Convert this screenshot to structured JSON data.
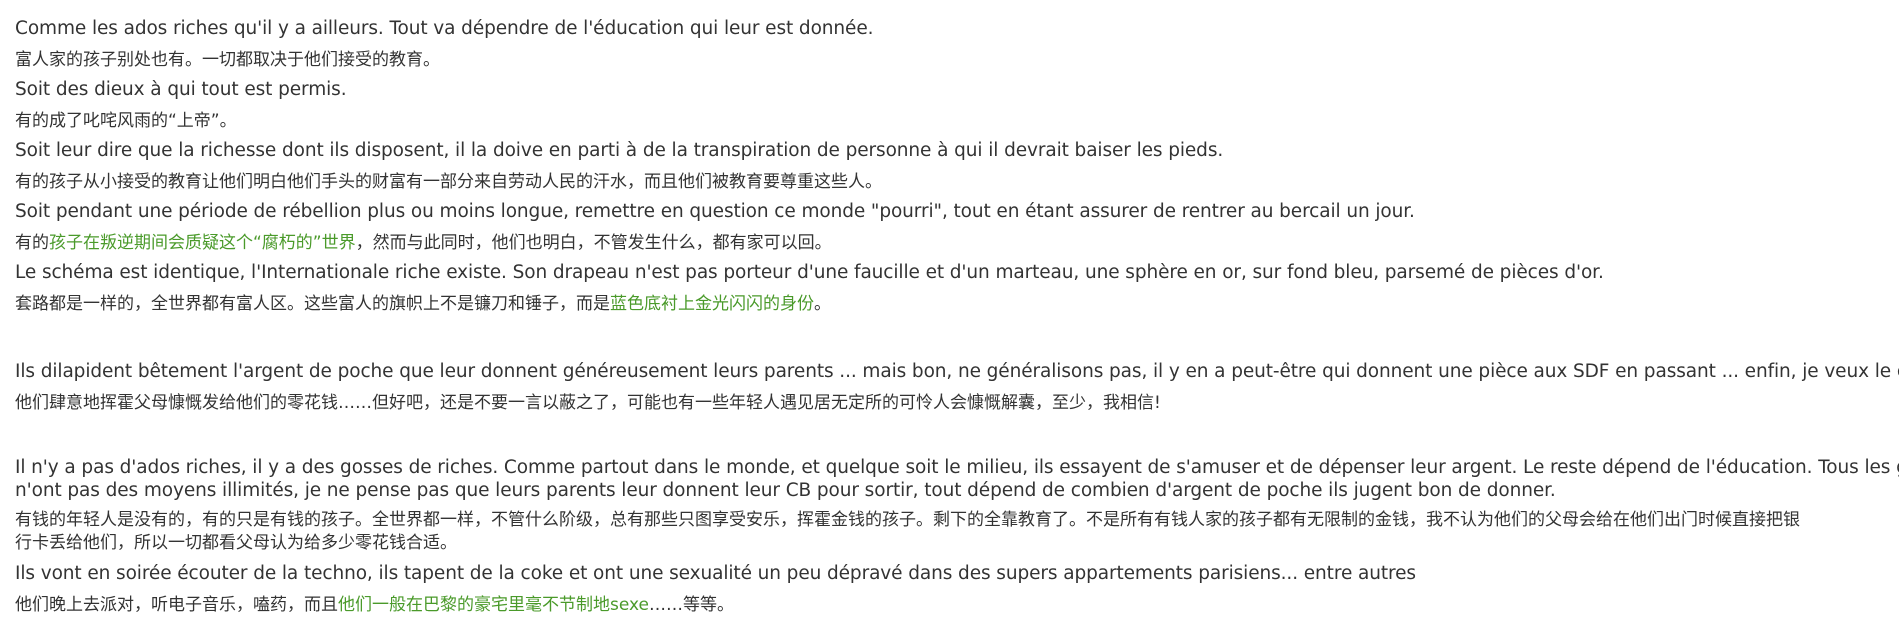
{
  "lines": [
    {
      "lang": "fr",
      "text": "Comme les ados riches qu'il y a ailleurs. Tout va dépendre de l'éducation qui leur est donnée."
    },
    {
      "lang": "zh",
      "text": "富人家的孩子别处也有。一切都取决于他们接受的教育。"
    },
    {
      "lang": "fr",
      "text": "Soit des dieux à qui tout est permis."
    },
    {
      "lang": "zh",
      "text": "有的成了叱咤风雨的“上帝”。"
    },
    {
      "lang": "fr",
      "text": "Soit leur dire que la richesse dont ils disposent, il la doive en parti à de la transpiration de personne à qui il devrait baiser les pieds."
    },
    {
      "lang": "zh",
      "text": "有的孩子从小接受的教育让他们明白他们手头的财富有一部分来自劳动人民的汗水，而且他们被教育要尊重这些人。"
    },
    {
      "lang": "fr",
      "text": "Soit pendant une période de rébellion plus ou moins longue, remettre en question ce monde \"pourri\", tout en étant assurer de rentrer au bercail un jour."
    },
    {
      "lang": "zh",
      "pre": "有的",
      "hl": "孩子在叛逆期间会质疑这个“腐朽的”世界",
      "post": "，然而与此同时，他们也明白，不管发生什么，都有家可以回。"
    },
    {
      "lang": "fr",
      "text": "Le schéma est identique, l'Internationale riche existe. Son drapeau n'est pas porteur d'une faucille et d'un marteau, une sphère en or, sur fond bleu, parsemé de pièces d'or."
    },
    {
      "lang": "zh",
      "pre": "套路都是一样的，全世界都有富人区。这些富人的旗帜上不是镰刀和锤子，而是",
      "hl": "蓝色底衬上金光闪闪的身份",
      "post": "。"
    }
  ],
  "block2": [
    {
      "lang": "fr",
      "text": "Ils dilapident bêtement l'argent de poche que leur donnent généreusement leurs parents ... mais bon, ne généralisons pas, il y en a peut-être qui donnent une pièce aux SDF en passant ... enfin, je veux le croire !!"
    },
    {
      "lang": "zh",
      "text": "他们肆意地挥霍父母慷慨发给他们的零花钱……但好吧，还是不要一言以蔽之了，可能也有一些年轻人遇见居无定所的可怜人会慷慨解囊，至少，我相信!"
    }
  ],
  "block3": {
    "fr_line1": "Il n'y a pas d'ados riches, il y a des gosses de riches. Comme partout dans le monde, et quelque soit le milieu, ils essayent de s'amuser et de dépenser leur argent. Le reste dépend de l'éducation. Tous les gosses de riches",
    "fr_line2": "n'ont pas des moyens illimités, je ne pense pas que leurs parents leur donnent leur CB pour sortir, tout dépend de combien d'argent de poche ils jugent bon de donner.",
    "zh_line1": "有钱的年轻人是没有的，有的只是有钱的孩子。全世界都一样，不管什么阶级，总有那些只图享受安乐，挥霍金钱的孩子。剩下的全靠教育了。不是所有有钱人家的孩子都有无限制的金钱，我不认为他们的父母会给在他们出门时候直接把银",
    "zh_line2": "行卡丢给他们，所以一切都看父母认为给多少零花钱合适。",
    "fr_line3": "Ils vont en soirée écouter de la techno, ils tapent de la coke et ont une sexualité un peu dépravé dans des supers appartements parisiens... entre autres",
    "zh_line3_pre": "他们晚上去派对，听电子音乐，嗑药，而且",
    "zh_line3_hl": "他们一般在巴黎的豪宅里毫不节制地sexe",
    "zh_line3_post": "……等等。"
  },
  "colors": {
    "text": "#333333",
    "highlight": "#4a9a2a",
    "background": "#ffffff"
  }
}
